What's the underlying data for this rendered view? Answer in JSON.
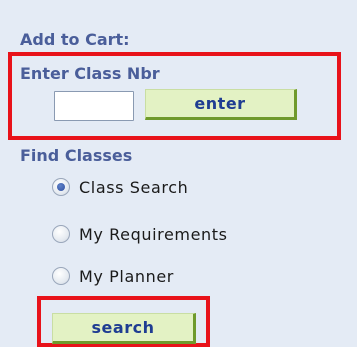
{
  "add_to_cart": {
    "title": "Add to Cart:",
    "class_nbr_label": "Enter Class Nbr",
    "class_nbr_value": "",
    "enter_button": "enter"
  },
  "find_classes": {
    "title": "Find Classes",
    "options": [
      {
        "label": "Class Search",
        "selected": true
      },
      {
        "label": "My Requirements",
        "selected": false
      },
      {
        "label": "My Planner",
        "selected": false
      }
    ],
    "search_button": "search"
  },
  "colors": {
    "background": "#e4ebf5",
    "section_title": "#4a5e9a",
    "highlight_border": "#e8121a",
    "button_bg": "#e3f2c4",
    "button_text": "#1f3d92",
    "button_shadow": "#6f9a2c"
  }
}
